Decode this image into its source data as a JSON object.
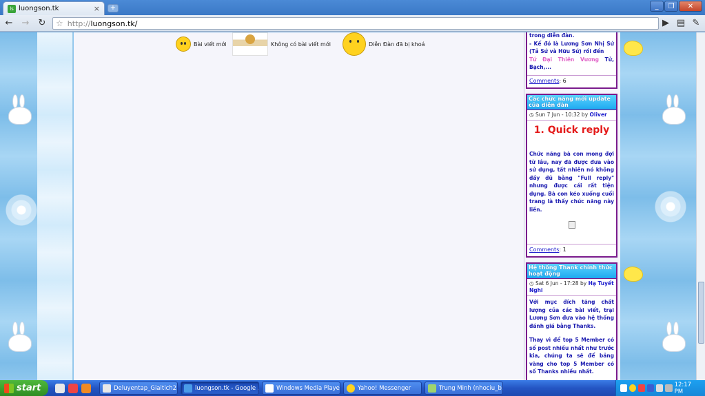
{
  "browser": {
    "tab_title": "luongson.tk",
    "tab_icon": "site-favicon",
    "url_scheme": "http://",
    "url_rest": "luongson.tk/",
    "favicon_text": "ls"
  },
  "legend": {
    "new_posts": "Bài viết mới",
    "no_new_posts": "Không có bài viết mới",
    "locked": "Diễn Đàn đã bị khoá"
  },
  "sidebar": {
    "box1": {
      "body_lines": [
        "trong diễn đàn.",
        "- Kế đó là Lương Sơn Nhị Sứ (Tả Sứ và Hữu Sứ) rồi đến"
      ],
      "body_pink": "Tứ Đại Thiên Vương",
      "body_end": " Tử, Bạch,...",
      "comments_label": "Comments",
      "comments_count": ": 6"
    },
    "box2": {
      "title": "Các chức năng mới update của diễn đàn",
      "date": "Sun 7 Jun - 10:32 by",
      "author": "Oliver",
      "headline": "1. Quick reply",
      "body": "Chức năng bà con mong đợi từ lâu, nay đã được đưa vào sử dụng, tất nhiên nó không đầy đủ bằng \"Full reply\" nhưng được cái rất tiện dụng. Bà con kéo xuống cuối trang là thấy chức năng này liền.",
      "comments_label": "Comments",
      "comments_count": ": 1"
    },
    "box3": {
      "title": "Hệ thống Thank chính thức hoạt động",
      "date": "Sat 6 Jun - 17:28 by",
      "author": "Hạ Tuyết Nghi",
      "body1": "Với mục đích tăng chất lượng của các bài viết, trại Lương Sơn đưa vào hệ thống đánh giá bằng Thanks.",
      "body2": "Thay vì để top 5 Member có số post nhiều nhất như trước kia, chúng ta sẽ để bảng vàng cho top 5 Member có số Thanks nhiều nhất."
    }
  },
  "taskbar": {
    "start_label": "start",
    "tasks": [
      {
        "label": "Deluyentap_Giaitich2...",
        "color": "#e8e8e8"
      },
      {
        "label": "luongson.tk - Google ...",
        "color": "#4a9be8"
      },
      {
        "label": "Windows Media Player",
        "color": "#ffffff"
      },
      {
        "label": "Yahoo! Messenger",
        "color": "#ffd21f"
      },
      {
        "label": "Trung Minh (nhociu_b...",
        "color": "#9fd46e"
      }
    ],
    "clock": "12:17 PM"
  },
  "colors": {
    "accent_purple": "#7a1a8c",
    "header_blue": "#1ea9f0",
    "link_blue": "#1a1acc",
    "headline_red": "#e41a1a"
  }
}
